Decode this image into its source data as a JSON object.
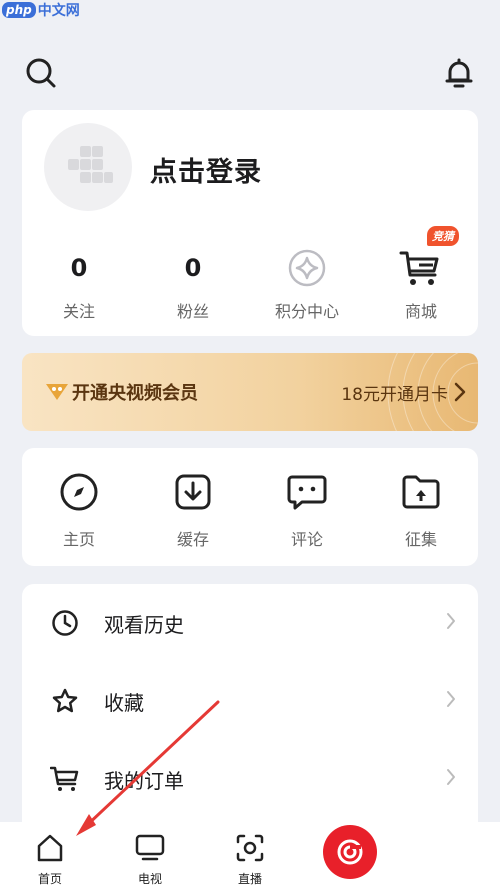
{
  "watermark": {
    "brand": "php",
    "site": "中文网"
  },
  "profile": {
    "login_text": "点击登录",
    "stats": [
      {
        "value": "0",
        "label": "关注"
      },
      {
        "value": "0",
        "label": "粉丝"
      },
      {
        "label": "积分中心",
        "icon": "points-icon"
      },
      {
        "label": "商城",
        "icon": "cart-icon",
        "badge": "竞猜"
      }
    ]
  },
  "vip": {
    "title": "开通央视频会员",
    "offer": "18元开通月卡"
  },
  "quick": [
    {
      "label": "主页",
      "icon": "compass-icon"
    },
    {
      "label": "缓存",
      "icon": "download-icon"
    },
    {
      "label": "评论",
      "icon": "comment-icon"
    },
    {
      "label": "征集",
      "icon": "folder-upload-icon"
    }
  ],
  "menu": [
    {
      "label": "观看历史",
      "icon": "clock-icon"
    },
    {
      "label": "收藏",
      "icon": "star-icon"
    },
    {
      "label": "我的订单",
      "icon": "cart-icon"
    }
  ],
  "tabs": [
    {
      "label": "首页",
      "icon": "home-icon"
    },
    {
      "label": "电视",
      "icon": "tv-icon"
    },
    {
      "label": "直播",
      "icon": "live-icon"
    }
  ],
  "colors": {
    "accent": "#e8202a",
    "badge": "#f0532d",
    "vip_text": "#5a3510",
    "annotation": "#e53935"
  }
}
